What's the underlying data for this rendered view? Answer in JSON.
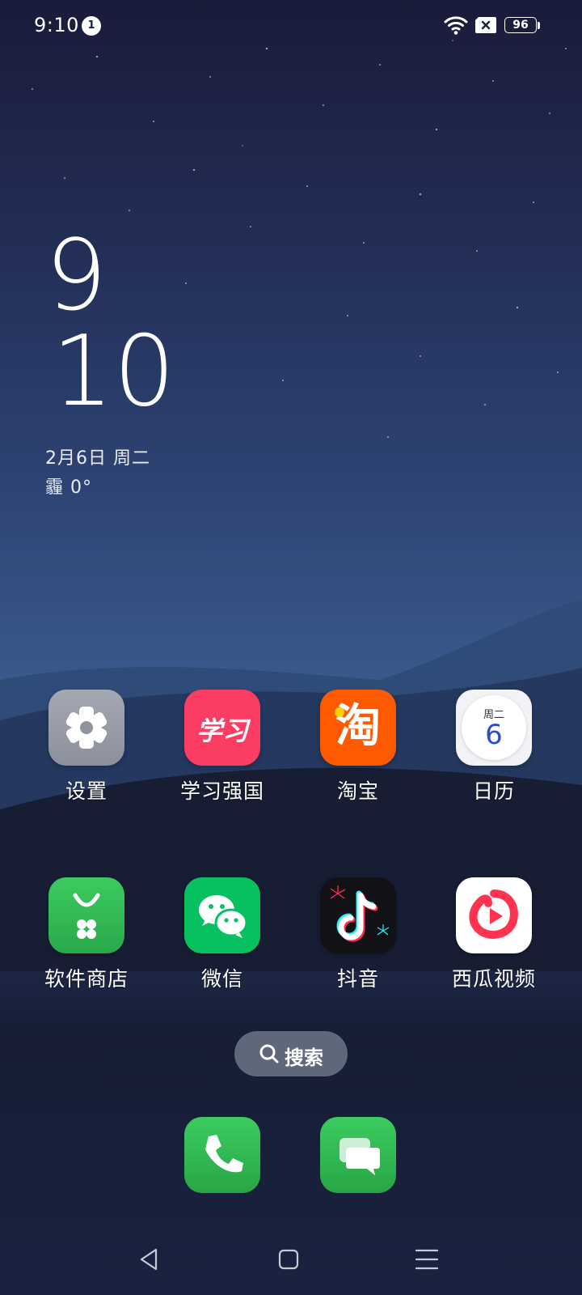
{
  "status_bar": {
    "time": "9:10",
    "notification_count": "1",
    "battery_level": "96",
    "icons": [
      "wifi-icon",
      "sim-no-signal-icon",
      "battery-icon"
    ]
  },
  "clock_widget": {
    "hour": "9",
    "minute": "10",
    "date": "2月6日  周二",
    "weather": "霾  0°"
  },
  "apps_row1": [
    {
      "label": "设置",
      "icon": "settings-gear-icon"
    },
    {
      "label": "学习强国",
      "icon": "xuexi-qiangguo-icon",
      "icon_text": "学习"
    },
    {
      "label": "淘宝",
      "icon": "taobao-icon",
      "icon_text": "淘"
    },
    {
      "label": "日历",
      "icon": "calendar-icon",
      "icon_weekday": "周二",
      "icon_day": "6"
    }
  ],
  "apps_row2": [
    {
      "label": "软件商店",
      "icon": "app-store-icon"
    },
    {
      "label": "微信",
      "icon": "wechat-icon"
    },
    {
      "label": "抖音",
      "icon": "douyin-icon"
    },
    {
      "label": "西瓜视频",
      "icon": "xigua-video-icon"
    }
  ],
  "search": {
    "label": "搜索"
  },
  "dock": [
    {
      "icon": "phone-icon"
    },
    {
      "icon": "messages-icon"
    }
  ],
  "nav_bar": [
    "back-icon",
    "home-icon",
    "recents-menu-icon"
  ],
  "colors": {
    "taobao": "#ff5a00",
    "xuexi": "#ff3a5c",
    "wechat": "#07c160",
    "store_green": "#34c05a",
    "calendar_blue": "#2a4cd0",
    "xigua_red": "#ff3350"
  }
}
